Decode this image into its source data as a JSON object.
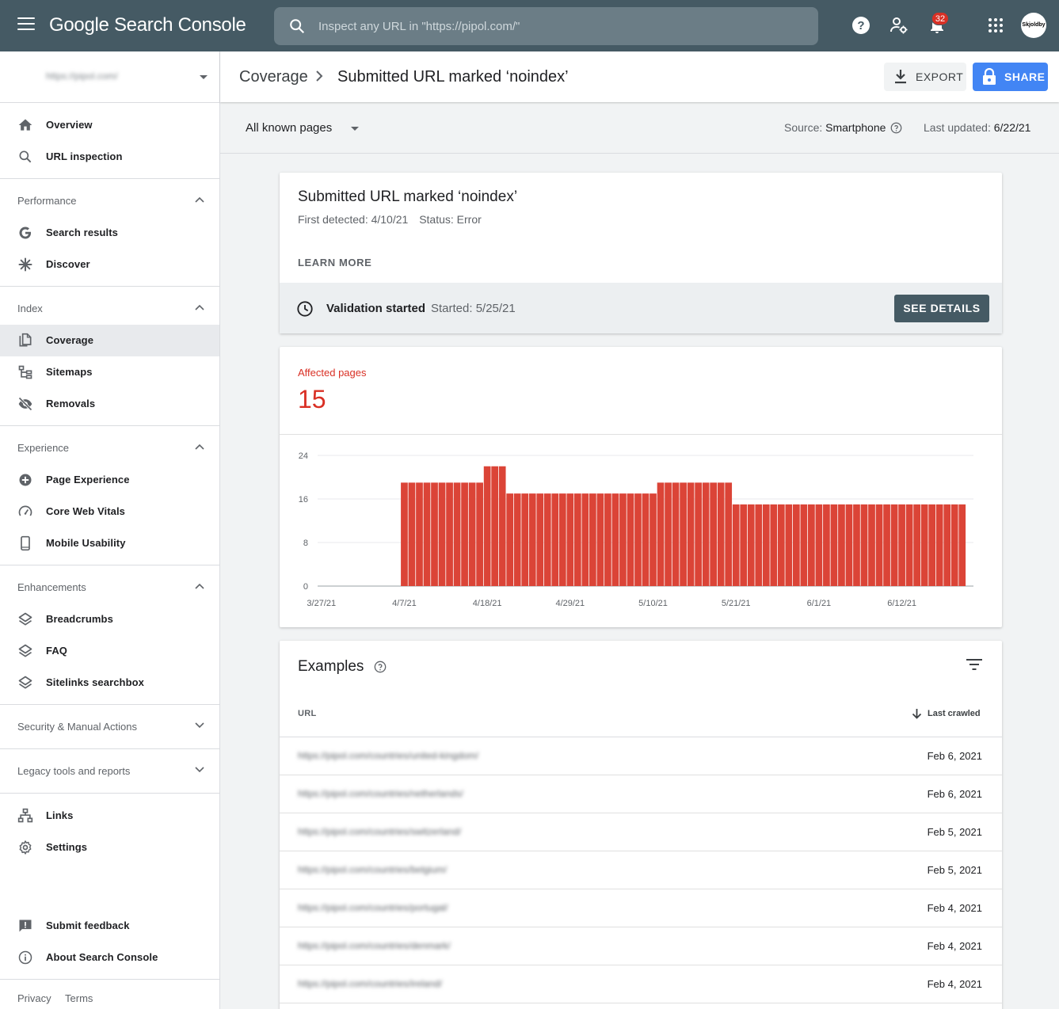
{
  "app": {
    "title": "Google Search Console",
    "search_placeholder": "Inspect any URL in \"https://pipol.com/\"",
    "notification_count": "32",
    "avatar_text": "Skjoldby"
  },
  "sidebar": {
    "property": "https://pipol.com/",
    "top_items": [
      {
        "label": "Overview",
        "icon": "home-icon"
      },
      {
        "label": "URL inspection",
        "icon": "search-icon"
      }
    ],
    "sections": [
      {
        "title": "Performance",
        "expanded": true,
        "items": [
          {
            "label": "Search results",
            "icon": "google-g-icon"
          },
          {
            "label": "Discover",
            "icon": "asterisk-icon"
          }
        ]
      },
      {
        "title": "Index",
        "expanded": true,
        "items": [
          {
            "label": "Coverage",
            "icon": "copy-icon",
            "active": true
          },
          {
            "label": "Sitemaps",
            "icon": "sitemap-icon"
          },
          {
            "label": "Removals",
            "icon": "eye-off-icon"
          }
        ]
      },
      {
        "title": "Experience",
        "expanded": true,
        "items": [
          {
            "label": "Page Experience",
            "icon": "plus-circle-icon"
          },
          {
            "label": "Core Web Vitals",
            "icon": "speedometer-icon"
          },
          {
            "label": "Mobile Usability",
            "icon": "phone-icon"
          }
        ]
      },
      {
        "title": "Enhancements",
        "expanded": true,
        "items": [
          {
            "label": "Breadcrumbs",
            "icon": "layers-icon"
          },
          {
            "label": "FAQ",
            "icon": "layers-icon"
          },
          {
            "label": "Sitelinks searchbox",
            "icon": "layers-icon"
          }
        ]
      },
      {
        "title": "Security & Manual Actions",
        "expanded": false,
        "items": []
      },
      {
        "title": "Legacy tools and reports",
        "expanded": false,
        "items": []
      }
    ],
    "bottom_items": [
      {
        "label": "Links",
        "icon": "links-icon"
      },
      {
        "label": "Settings",
        "icon": "gear-icon"
      }
    ],
    "footer_items": [
      {
        "label": "Submit feedback",
        "icon": "feedback-icon"
      },
      {
        "label": "About Search Console",
        "icon": "info-icon"
      }
    ],
    "legal": {
      "privacy": "Privacy",
      "terms": "Terms"
    }
  },
  "header": {
    "breadcrumb_parent": "Coverage",
    "breadcrumb_current": "Submitted URL marked ‘noindex’",
    "export_label": "EXPORT",
    "share_label": "SHARE"
  },
  "filter": {
    "selected": "All known pages",
    "source_label": "Source:",
    "source_value": "Smartphone",
    "updated_label": "Last updated:",
    "updated_value": "6/22/21"
  },
  "issue": {
    "title": "Submitted URL marked ‘noindex’",
    "first_detected": "First detected: 4/10/21",
    "status": "Status: Error",
    "learn_more": "LEARN MORE",
    "validation_title": "Validation started",
    "validation_started": "Started: 5/25/21",
    "see_details": "SEE DETAILS"
  },
  "affected": {
    "label": "Affected pages",
    "value": "15"
  },
  "chart_data": {
    "type": "bar",
    "ylim": [
      0,
      24
    ],
    "yticks": [
      0,
      8,
      16,
      24
    ],
    "xticks": [
      "3/27/21",
      "4/7/21",
      "4/18/21",
      "4/29/21",
      "5/10/21",
      "5/21/21",
      "6/1/21",
      "6/12/21"
    ],
    "x_start": "3/27/21",
    "x_end": "6/22/21",
    "color": "#db4437",
    "segments": [
      {
        "from": "4/7/21",
        "to": "4/17/21",
        "value": 19
      },
      {
        "from": "4/18/21",
        "to": "4/20/21",
        "value": 22
      },
      {
        "from": "4/21/21",
        "to": "5/10/21",
        "value": 17
      },
      {
        "from": "5/11/21",
        "to": "5/20/21",
        "value": 19
      },
      {
        "from": "5/21/21",
        "to": "6/20/21",
        "value": 15
      }
    ]
  },
  "examples": {
    "title": "Examples",
    "col_url": "URL",
    "col_crawled": "Last crawled",
    "rows": [
      {
        "url": "https://pipol.com/countries/united-kingdom/",
        "date": "Feb 6, 2021"
      },
      {
        "url": "https://pipol.com/countries/netherlands/",
        "date": "Feb 6, 2021"
      },
      {
        "url": "https://pipol.com/countries/switzerland/",
        "date": "Feb 5, 2021"
      },
      {
        "url": "https://pipol.com/countries/belgium/",
        "date": "Feb 5, 2021"
      },
      {
        "url": "https://pipol.com/countries/portugal/",
        "date": "Feb 4, 2021"
      },
      {
        "url": "https://pipol.com/countries/denmark/",
        "date": "Feb 4, 2021"
      },
      {
        "url": "https://pipol.com/countries/ireland/",
        "date": "Feb 4, 2021"
      }
    ]
  }
}
